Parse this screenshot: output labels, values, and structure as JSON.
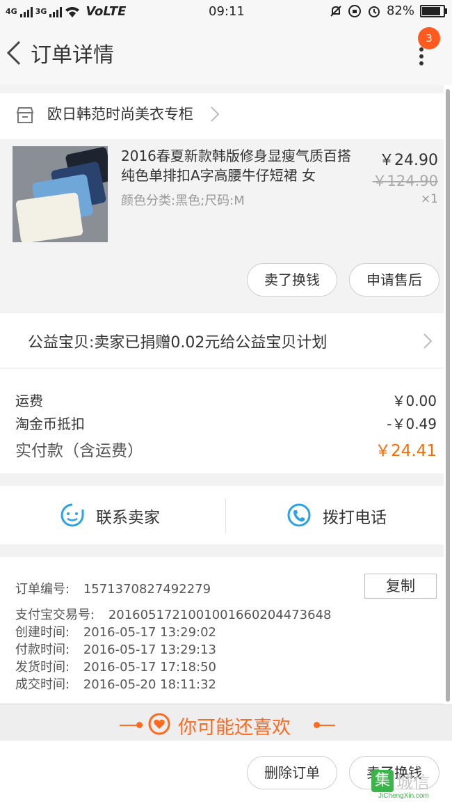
{
  "status_bar": {
    "network1": "4G",
    "network2": "3G",
    "volte": "VoLTE",
    "time": "09:11",
    "battery": "82%"
  },
  "header": {
    "title": "订单详情",
    "badge": "3"
  },
  "shop": {
    "name": "欧日韩范时尚美衣专柜"
  },
  "item": {
    "title": "2016春夏新款韩版修身显瘦气质百搭纯色单排扣A字高腰牛仔短裙 女",
    "spec": "颜色分类:黑色;尺码:M",
    "price": "￥24.90",
    "original_price": "￥124.90",
    "quantity": "×1",
    "buttons": {
      "sell": "卖了换钱",
      "after_sale": "申请售后"
    }
  },
  "charity": {
    "text": "公益宝贝:卖家已捐赠0.02元给公益宝贝计划"
  },
  "fees": {
    "shipping_label": "运费",
    "shipping_value": "￥0.00",
    "coin_label": "淘金币抵扣",
    "coin_value": "-￥0.49",
    "total_label": "实付款（含运费）",
    "total_value": "￥24.41"
  },
  "contact": {
    "chat_label": "联系卖家",
    "call_label": "拨打电话"
  },
  "order_info": {
    "order_no_label": "订单编号:",
    "order_no": "1571370827492279",
    "copy_label": "复制",
    "alipay_label": "支付宝交易号:",
    "alipay_no": "2016051721001001660204473648",
    "created_label": "创建时间:",
    "created": "2016-05-17  13:29:02",
    "paid_label": "付款时间:",
    "paid": "2016-05-17  13:29:13",
    "shipped_label": "发货时间:",
    "shipped": "2016-05-17  17:18:50",
    "closed_label": "成交时间:",
    "closed": "2016-05-20  18:11:32"
  },
  "recommend": {
    "title": "你可能还喜欢"
  },
  "bottom_bar": {
    "delete_label": "删除订单",
    "sell_label": "卖了换钱"
  },
  "watermark": {
    "main": "城信",
    "sub": "JiChengXin.com"
  },
  "colors": {
    "accent": "#ff6a00",
    "icon_blue": "#2aa3e6",
    "badge": "#ff5a1f"
  }
}
